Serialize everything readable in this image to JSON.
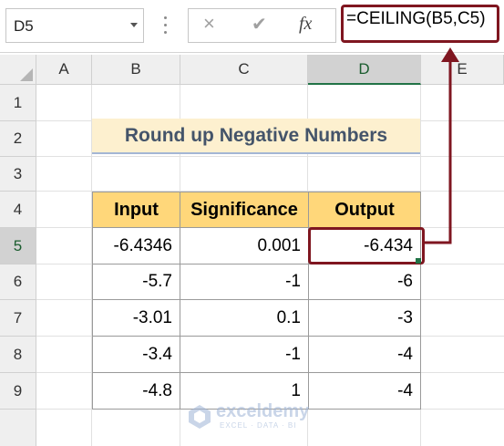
{
  "name_box": {
    "value": "D5"
  },
  "formula_bar": {
    "cancel_icon": "×",
    "enter_icon": "✔",
    "function_icon": "fx",
    "formula": "=CEILING(B5,C5)"
  },
  "columns": [
    "A",
    "B",
    "C",
    "D",
    "E"
  ],
  "rows": [
    "1",
    "2",
    "3",
    "4",
    "5",
    "6",
    "7",
    "8",
    "9"
  ],
  "selected_cell": {
    "column": "D",
    "row": "5"
  },
  "sheet": {
    "title": "Round up Negative Numbers",
    "table": {
      "headers": [
        "Input",
        "Significance",
        "Output"
      ],
      "rows": [
        [
          "-6.4346",
          "0.001",
          "-6.434"
        ],
        [
          "-5.7",
          "-1",
          "-6"
        ],
        [
          "-3.01",
          "0.1",
          "-3"
        ],
        [
          "-3.4",
          "-1",
          "-4"
        ],
        [
          "-4.8",
          "1",
          "-4"
        ]
      ]
    }
  },
  "watermark": {
    "brand": "exceldemy",
    "tagline": "EXCEL · DATA · BI"
  },
  "colors": {
    "title_fill": "#fdf0cf",
    "header_fill": "#ffd77a",
    "highlight": "#7f1620",
    "title_text": "#44546a"
  }
}
